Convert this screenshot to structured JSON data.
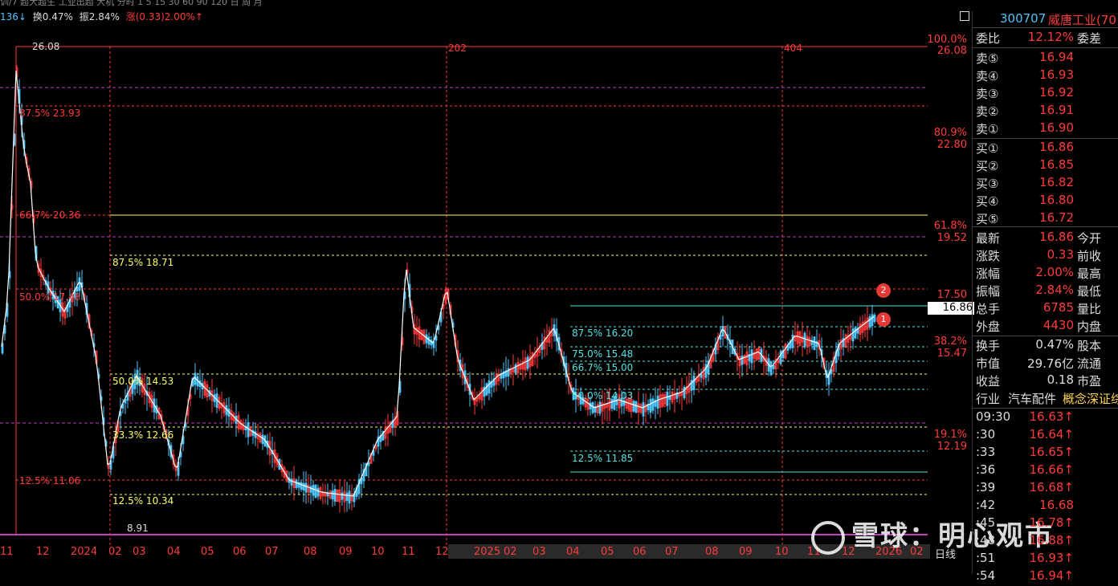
{
  "topbar": {
    "text": "训/7 超大超生 工业出超 大机 分时 1 5 15 30 60 90 120 日 周 月"
  },
  "stats": {
    "num": "136↓",
    "turnover": "换0.47%",
    "amplitude": "振2.84%",
    "change": "涨(0.33)2.00%↑"
  },
  "axis_labels": {
    "pct_top": "100.0%",
    "price_top": "26.08",
    "pct_2": "80.9%",
    "price_2": "22.80",
    "pct_3": "61.8%",
    "price_3": "19.52",
    "price_4": "17.50",
    "pct_5": "38.2%",
    "price_5": "15.47",
    "pct_6": "19.1%",
    "price_6": "12.19"
  },
  "current_price_tag": "16.86",
  "chart_labels": {
    "high": "26.08",
    "low": "8.91",
    "marker_202": "202",
    "marker_404": "404",
    "fib_left": [
      "87.5% 23.93",
      "66.7% 20.36",
      "50.0% 17.48",
      "12.5% 11.06"
    ],
    "fib_mid": [
      "87.5% 18.71",
      "50.0% 14.53",
      "33.3% 12.66",
      "12.5% 10.34"
    ],
    "fib_right": [
      "87.5% 16.20",
      "75.0% 15.48",
      "66.7% 15.00",
      "50.0% 14.03",
      "12.5% 11.85"
    ],
    "badge1": "1",
    "badge2": "2"
  },
  "xaxis": {
    "ticks": [
      "11",
      "12",
      "2024",
      "02",
      "03",
      "04",
      "05",
      "06",
      "07",
      "08",
      "09",
      "10",
      "11",
      "12",
      "2025",
      "02",
      "03",
      "04",
      "05",
      "06",
      "07",
      "08",
      "09",
      "10",
      "11",
      "12",
      "2026",
      "02"
    ],
    "period": "日线"
  },
  "panel": {
    "code": "300707",
    "name": "威唐工业(70",
    "ratio_label": "委比",
    "ratio": "12.12%",
    "diff_label": "委差",
    "sell": [
      {
        "k": "卖⑤",
        "v": "16.94"
      },
      {
        "k": "卖④",
        "v": "16.93"
      },
      {
        "k": "卖③",
        "v": "16.92"
      },
      {
        "k": "卖②",
        "v": "16.91"
      },
      {
        "k": "卖①",
        "v": "16.90"
      }
    ],
    "buy": [
      {
        "k": "买①",
        "v": "16.86"
      },
      {
        "k": "买②",
        "v": "16.85"
      },
      {
        "k": "买③",
        "v": "16.82"
      },
      {
        "k": "买④",
        "v": "16.80"
      },
      {
        "k": "买⑤",
        "v": "16.72"
      }
    ],
    "quote": [
      {
        "k": "最新",
        "v": "16.86",
        "k2": "今开"
      },
      {
        "k": "涨跌",
        "v": "0.33",
        "k2": "前收"
      },
      {
        "k": "涨幅",
        "v": "2.00%",
        "k2": "最高"
      },
      {
        "k": "振幅",
        "v": "2.84%",
        "k2": "最低"
      },
      {
        "k": "总手",
        "v": "6785",
        "k2": "量比"
      },
      {
        "k": "外盘",
        "v": "4430",
        "k2": "内盘"
      }
    ],
    "info": [
      {
        "k": "换手",
        "v": "0.47%",
        "k2": "股本"
      },
      {
        "k": "市值",
        "v": "29.76亿",
        "k2": "流通"
      },
      {
        "k": "收益",
        "v": "0.18",
        "k2": "市盈"
      }
    ],
    "industry_label": "行业",
    "industry": "汽车配件",
    "concept": "概念深证综",
    "ticks": [
      {
        "t": "09:30",
        "p": "16.63↑"
      },
      {
        "t": ":30",
        "p": "16.64↑"
      },
      {
        "t": ":33",
        "p": "16.65↑"
      },
      {
        "t": ":36",
        "p": "16.66↑"
      },
      {
        "t": ":39",
        "p": "16.68↑"
      },
      {
        "t": ":42",
        "p": "16.68"
      },
      {
        "t": ":45",
        "p": "16.78↑"
      },
      {
        "t": ":48",
        "p": "16.88↑"
      },
      {
        "t": ":51",
        "p": "16.93↑"
      },
      {
        "t": ":54",
        "p": "16.94↑"
      }
    ]
  },
  "watermark": "雪球：明心观市",
  "colors": {
    "up": "#ff3b3b",
    "down": "#4fc3f7",
    "fib_left": "#ff3b3b",
    "fib_mid": "#ffff66",
    "fib_right": "#4fe3e3"
  }
}
